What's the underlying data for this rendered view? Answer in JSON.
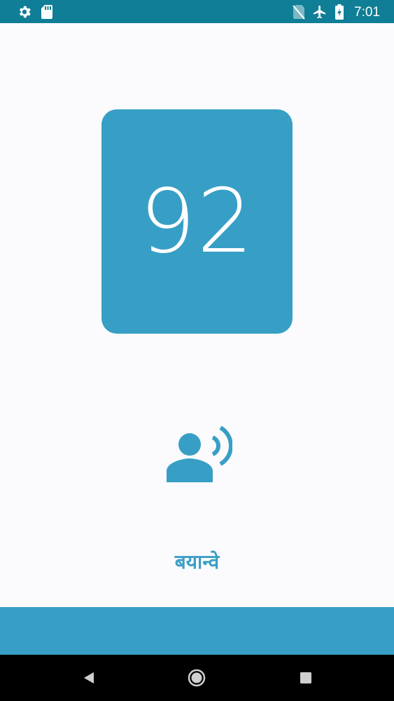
{
  "status_bar": {
    "time": "7:01",
    "icons": [
      "gear-icon",
      "sd-card-icon",
      "no-sim-icon",
      "airplane-icon",
      "battery-charging-icon"
    ]
  },
  "main": {
    "number": "92",
    "word": "बयान्वे",
    "speak_icon": "record-voice-over-icon"
  },
  "nav_bar": {
    "icons": [
      "back-icon",
      "home-icon",
      "recents-icon"
    ]
  },
  "colors": {
    "status_bar": "#0f7e96",
    "accent": "#379fc5",
    "background": "#fbfbfd",
    "nav_bar": "#000000",
    "word_text": "#3d9fc6"
  }
}
